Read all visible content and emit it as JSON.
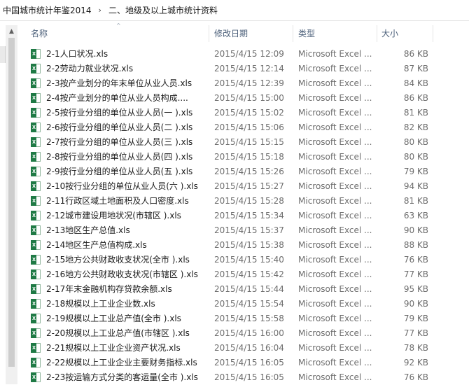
{
  "breadcrumb": {
    "items": [
      "中国城市统计年鉴2014",
      "二、地级及以上城市统计资料"
    ],
    "separator": "›"
  },
  "columns": {
    "name": "名称",
    "date": "修改日期",
    "type": "类型",
    "size": "大小"
  },
  "files": [
    {
      "name": "2-1人口状况.xls",
      "date": "2015/4/15 12:09",
      "type": "Microsoft Excel ...",
      "size": "86 KB"
    },
    {
      "name": "2-2劳动力就业状况.xls",
      "date": "2015/4/15 12:14",
      "type": "Microsoft Excel ...",
      "size": "87 KB"
    },
    {
      "name": "2-3按产业划分的年末单位从业人员.xls",
      "date": "2015/4/15 12:39",
      "type": "Microsoft Excel ...",
      "size": "84 KB"
    },
    {
      "name": "2-4按产业划分的单位从业人员构成....",
      "date": "2015/4/15 15:00",
      "type": "Microsoft Excel ...",
      "size": "86 KB"
    },
    {
      "name": "2-5按行业分组的单位从业人员(一 ).xls",
      "date": "2015/4/15 15:02",
      "type": "Microsoft Excel ...",
      "size": "81 KB"
    },
    {
      "name": "2-6按行业分组的单位从业人员(二 ).xls",
      "date": "2015/4/15 15:06",
      "type": "Microsoft Excel ...",
      "size": "82 KB"
    },
    {
      "name": "2-7按行业分组的单位从业人员(三 ).xls",
      "date": "2015/4/15 15:15",
      "type": "Microsoft Excel ...",
      "size": "80 KB"
    },
    {
      "name": "2-8按行业分组的单位从业人员(四 ).xls",
      "date": "2015/4/15 15:18",
      "type": "Microsoft Excel ...",
      "size": "80 KB"
    },
    {
      "name": "2-9按行业分组的单位从业人员(五 ).xls",
      "date": "2015/4/15 15:26",
      "type": "Microsoft Excel ...",
      "size": "79 KB"
    },
    {
      "name": "2-10按行业分组的单位从业人员(六 ).xls",
      "date": "2015/4/15 15:27",
      "type": "Microsoft Excel ...",
      "size": "94 KB"
    },
    {
      "name": "2-11行政区域土地面积及人口密度.xls",
      "date": "2015/4/15 15:28",
      "type": "Microsoft Excel ...",
      "size": "81 KB"
    },
    {
      "name": "2-12城市建设用地状况(市辖区 ).xls",
      "date": "2015/4/15 15:34",
      "type": "Microsoft Excel ...",
      "size": "63 KB"
    },
    {
      "name": "2-13地区生产总值.xls",
      "date": "2015/4/15 15:37",
      "type": "Microsoft Excel ...",
      "size": "90 KB"
    },
    {
      "name": "2-14地区生产总值构成.xls",
      "date": "2015/4/15 15:38",
      "type": "Microsoft Excel ...",
      "size": "88 KB"
    },
    {
      "name": "2-15地方公共财政收支状况(全市 ).xls",
      "date": "2015/4/15 15:40",
      "type": "Microsoft Excel ...",
      "size": "76 KB"
    },
    {
      "name": "2-16地方公共财政收支状况(市辖区 ).xls",
      "date": "2015/4/15 15:42",
      "type": "Microsoft Excel ...",
      "size": "77 KB"
    },
    {
      "name": "2-17年末金融机构存贷款余额.xls",
      "date": "2015/4/15 15:44",
      "type": "Microsoft Excel ...",
      "size": "95 KB"
    },
    {
      "name": "2-18规模以上工业企业数.xls",
      "date": "2015/4/15 15:54",
      "type": "Microsoft Excel ...",
      "size": "90 KB"
    },
    {
      "name": "2-19规模以上工业总产值(全市 ).xls",
      "date": "2015/4/15 15:58",
      "type": "Microsoft Excel ...",
      "size": "79 KB"
    },
    {
      "name": "2-20规模以上工业总产值(市辖区 ).xls",
      "date": "2015/4/15 16:00",
      "type": "Microsoft Excel ...",
      "size": "77 KB"
    },
    {
      "name": "2-21规模以上工业企业资产状况.xls",
      "date": "2015/4/15 16:04",
      "type": "Microsoft Excel ...",
      "size": "78 KB"
    },
    {
      "name": "2-22规模以上工业企业主要财务指标.xls",
      "date": "2015/4/15 16:05",
      "type": "Microsoft Excel ...",
      "size": "92 KB"
    },
    {
      "name": "2-23按运输方式分类的客运量(全市 ).xls",
      "date": "2015/4/15 16:05",
      "type": "Microsoft Excel ...",
      "size": "76 KB"
    }
  ]
}
